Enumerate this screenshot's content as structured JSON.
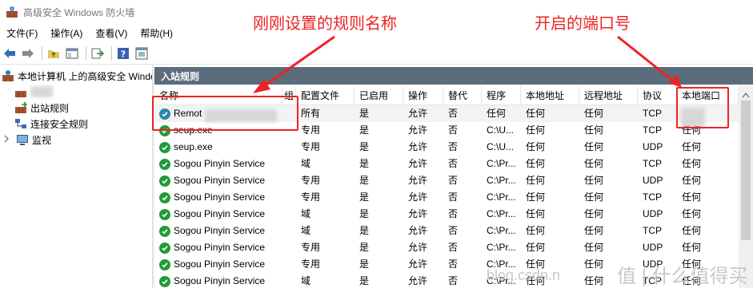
{
  "window": {
    "title": "高级安全 Windows 防火墙"
  },
  "menubar": [
    {
      "label": "文件(F)"
    },
    {
      "label": "操作(A)"
    },
    {
      "label": "查看(V)"
    },
    {
      "label": "帮助(H)"
    }
  ],
  "toolbar": {
    "icons": [
      "back-arrow-icon",
      "forward-arrow-icon",
      "up-folder-icon",
      "show-hide-tree-icon",
      "export-list-icon",
      "help-icon",
      "properties-icon"
    ]
  },
  "tree": {
    "root": "本地计算机 上的高级安全 Windows",
    "items": [
      {
        "label": "",
        "icon": "inbound-rules-icon"
      },
      {
        "label": "出站规则",
        "icon": "outbound-rules-icon"
      },
      {
        "label": "连接安全规则",
        "icon": "connection-security-icon"
      },
      {
        "label": "监视",
        "icon": "monitor-icon"
      }
    ]
  },
  "main": {
    "section_title": "入站规则",
    "columns": [
      "名称",
      "组",
      "配置文件",
      "已启用",
      "操作",
      "替代",
      "程序",
      "本地地址",
      "远程地址",
      "协议",
      "本地端口"
    ],
    "rows": [
      {
        "name": "Remot",
        "group": "",
        "profile": "所有",
        "enabled": "是",
        "action": "允许",
        "override": "否",
        "program": "任何",
        "local_addr": "任何",
        "remote_addr": "任何",
        "protocol": "TCP",
        "local_port": ""
      },
      {
        "name": "seup.exe",
        "group": "",
        "profile": "专用",
        "enabled": "是",
        "action": "允许",
        "override": "否",
        "program": "C:\\U...",
        "local_addr": "任何",
        "remote_addr": "任何",
        "protocol": "TCP",
        "local_port": "任何"
      },
      {
        "name": "seup.exe",
        "group": "",
        "profile": "专用",
        "enabled": "是",
        "action": "允许",
        "override": "否",
        "program": "C:\\U...",
        "local_addr": "任何",
        "remote_addr": "任何",
        "protocol": "UDP",
        "local_port": "任何"
      },
      {
        "name": "Sogou Pinyin Service",
        "group": "",
        "profile": "域",
        "enabled": "是",
        "action": "允许",
        "override": "否",
        "program": "C:\\Pr...",
        "local_addr": "任何",
        "remote_addr": "任何",
        "protocol": "TCP",
        "local_port": "任何"
      },
      {
        "name": "Sogou Pinyin Service",
        "group": "",
        "profile": "专用",
        "enabled": "是",
        "action": "允许",
        "override": "否",
        "program": "C:\\Pr...",
        "local_addr": "任何",
        "remote_addr": "任何",
        "protocol": "UDP",
        "local_port": "任何"
      },
      {
        "name": "Sogou Pinyin Service",
        "group": "",
        "profile": "专用",
        "enabled": "是",
        "action": "允许",
        "override": "否",
        "program": "C:\\Pr...",
        "local_addr": "任何",
        "remote_addr": "任何",
        "protocol": "TCP",
        "local_port": "任何"
      },
      {
        "name": "Sogou Pinyin Service",
        "group": "",
        "profile": "域",
        "enabled": "是",
        "action": "允许",
        "override": "否",
        "program": "C:\\Pr...",
        "local_addr": "任何",
        "remote_addr": "任何",
        "protocol": "UDP",
        "local_port": "任何"
      },
      {
        "name": "Sogou Pinyin Service",
        "group": "",
        "profile": "域",
        "enabled": "是",
        "action": "允许",
        "override": "否",
        "program": "C:\\Pr...",
        "local_addr": "任何",
        "remote_addr": "任何",
        "protocol": "TCP",
        "local_port": "任何"
      },
      {
        "name": "Sogou Pinyin Service",
        "group": "",
        "profile": "专用",
        "enabled": "是",
        "action": "允许",
        "override": "否",
        "program": "C:\\Pr...",
        "local_addr": "任何",
        "remote_addr": "任何",
        "protocol": "UDP",
        "local_port": "任何"
      },
      {
        "name": "Sogou Pinyin Service",
        "group": "",
        "profile": "专用",
        "enabled": "是",
        "action": "允许",
        "override": "否",
        "program": "C:\\Pr...",
        "local_addr": "任何",
        "remote_addr": "任何",
        "protocol": "UDP",
        "local_port": "任何"
      },
      {
        "name": "Sogou Pinyin Service",
        "group": "",
        "profile": "域",
        "enabled": "是",
        "action": "允许",
        "override": "否",
        "program": "C:\\Pr...",
        "local_addr": "任何",
        "remote_addr": "任何",
        "protocol": "TCP",
        "local_port": "任何"
      }
    ]
  },
  "annotations": {
    "rule_name_note": "刚刚设置的规则名称",
    "port_note": "开启的端口号",
    "color": "#ee2222"
  },
  "watermark": {
    "text": "blog.csdn.n",
    "logo_text": "值 | 什么值得买"
  },
  "colors": {
    "section_header": "#5b6c7d",
    "check_green": "#1f9b3a",
    "check_teal": "#2a8aa8"
  }
}
